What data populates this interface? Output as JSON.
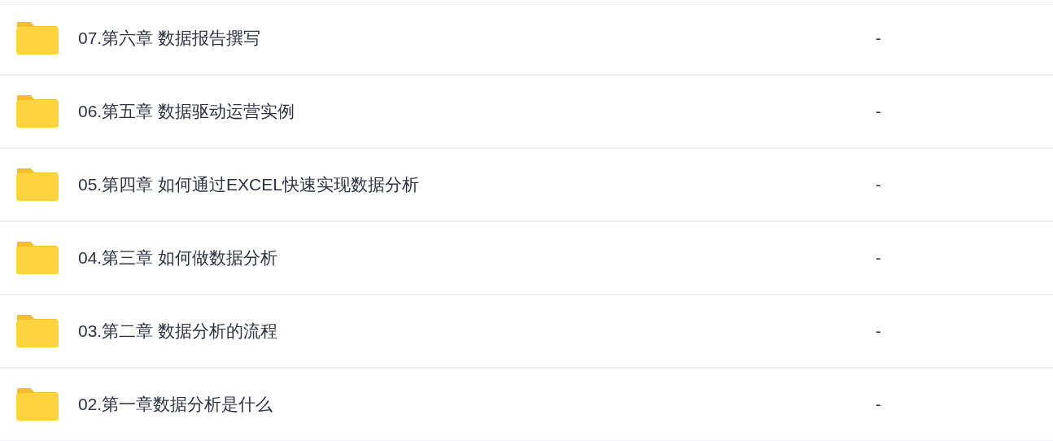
{
  "files": [
    {
      "name": "07.第六章 数据报告撰写",
      "size": "-"
    },
    {
      "name": "06.第五章 数据驱动运营实例",
      "size": "-"
    },
    {
      "name": "05.第四章 如何通过EXCEL快速实现数据分析",
      "size": "-"
    },
    {
      "name": "04.第三章 如何做数据分析",
      "size": "-"
    },
    {
      "name": "03.第二章 数据分析的流程",
      "size": "-"
    },
    {
      "name": "02.第一章数据分析是什么",
      "size": "-"
    }
  ]
}
